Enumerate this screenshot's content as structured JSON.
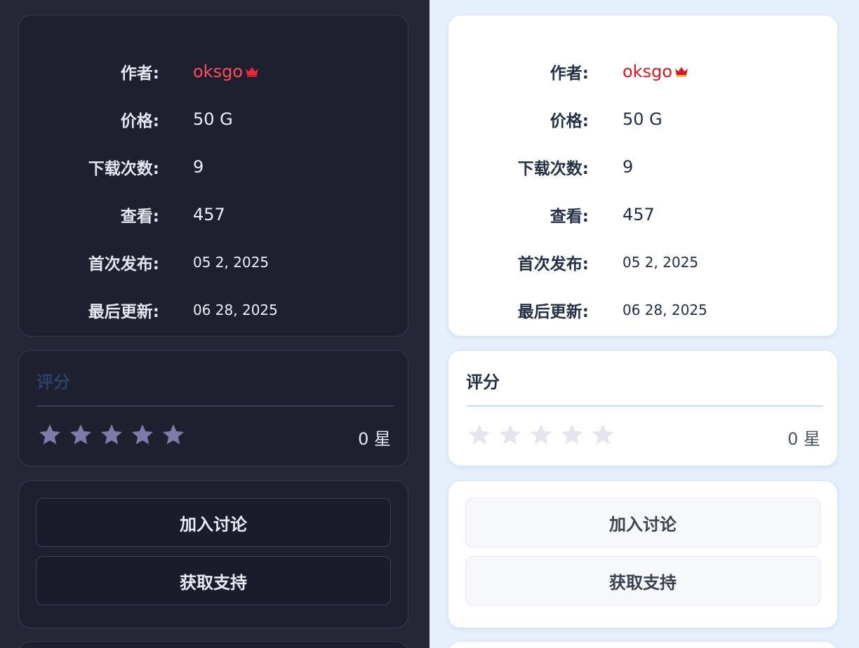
{
  "info": {
    "author_label": "作者:",
    "author_name": "oksgo",
    "author_badge_icon": "crown-icon",
    "price_label": "价格:",
    "price_value": "50 G",
    "downloads_label": "下载次数:",
    "downloads_value": "9",
    "views_label": "查看:",
    "views_value": "457",
    "first_release_label": "首次发布:",
    "first_release_value": "05 2, 2025",
    "last_update_label": "最后更新:",
    "last_update_value": "06 28, 2025"
  },
  "rating": {
    "title": "评分",
    "stars_filled": 0,
    "stars_total": 5,
    "count_text": "0 星"
  },
  "actions": {
    "join_discussion": "加入讨论",
    "get_support": "获取支持"
  },
  "colors": {
    "dark_bg": "#252636",
    "dark_card": "#1e1f2f",
    "light_bg": "#e6f0fb",
    "light_card": "#ffffff",
    "author_dark": "#ff4d5e",
    "author_light": "#e0141f"
  }
}
